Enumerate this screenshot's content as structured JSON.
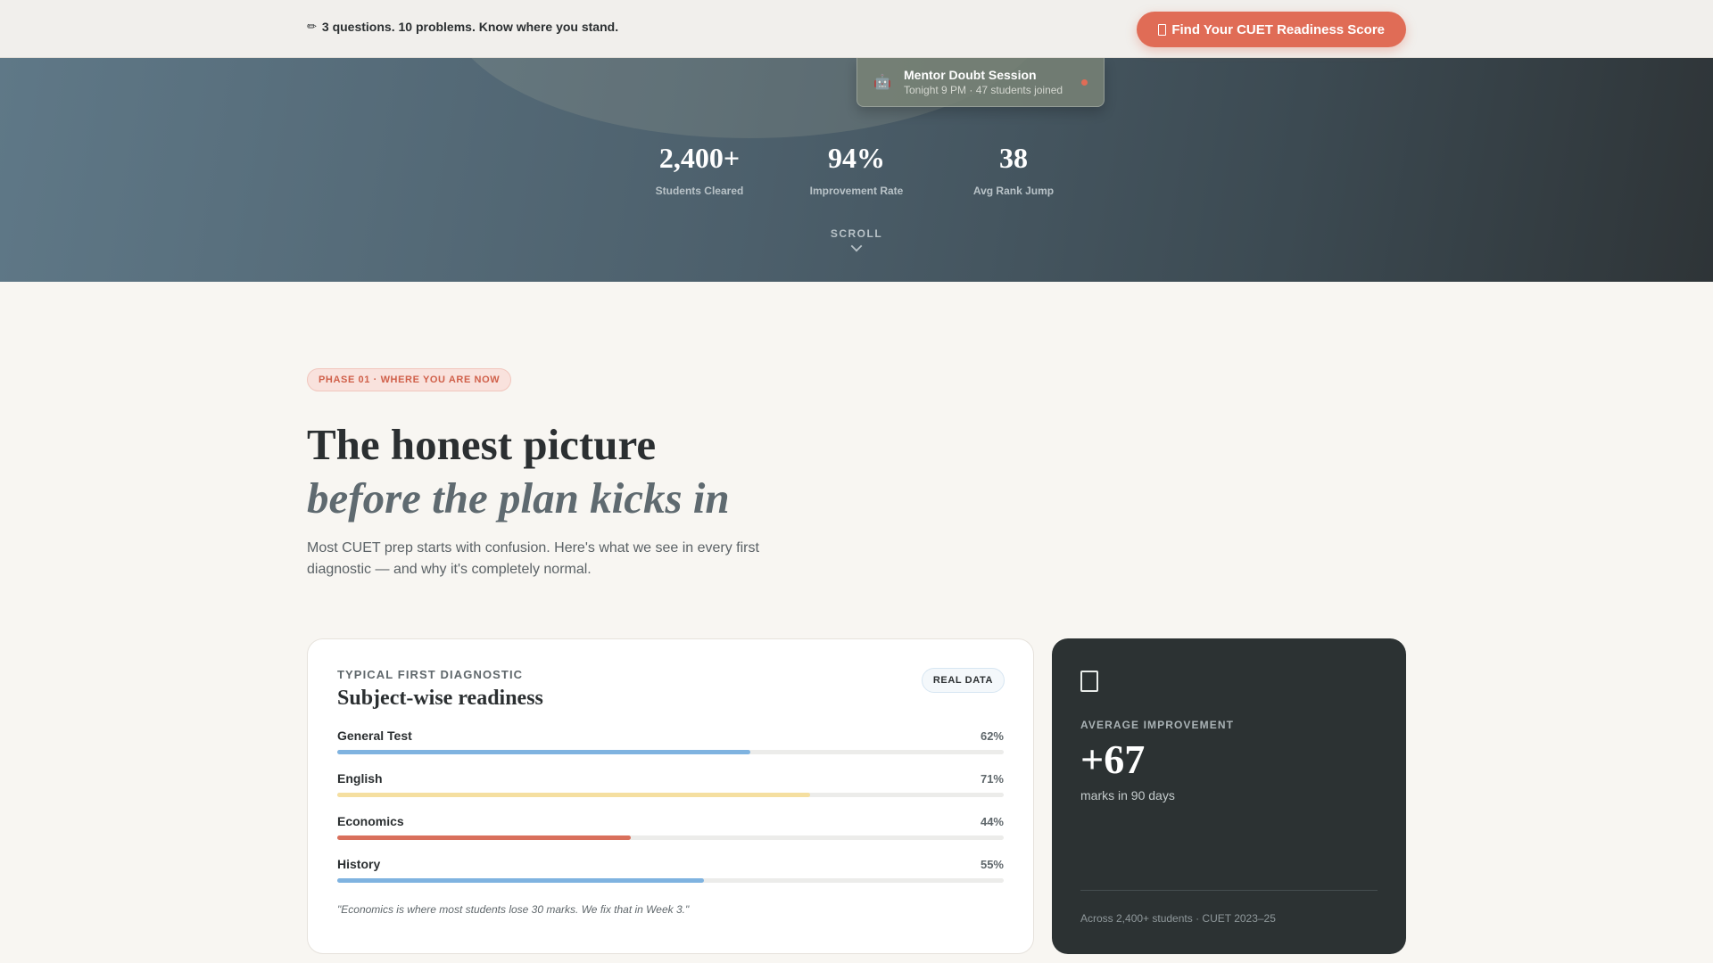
{
  "topbar": {
    "pencil_icon": "✏",
    "message": "3 questions. 10 problems. Know where you stand.",
    "cta_label": "Find Your CUET Readiness Score"
  },
  "hero": {
    "mentor": {
      "icon": "robot-icon",
      "title": "Mentor Doubt Session",
      "subtitle": "Tonight 9 PM · 47 students joined"
    },
    "stats": [
      {
        "value": "2,400+",
        "label": "Students Cleared"
      },
      {
        "value": "94%",
        "label": "Improvement Rate"
      },
      {
        "value": "38",
        "label": "Avg Rank Jump"
      }
    ],
    "scroll_label": "SCROLL"
  },
  "section": {
    "phase_badge": "PHASE 01 · WHERE YOU ARE NOW",
    "heading_line1": "The honest picture",
    "heading_line2": "before the plan kicks in",
    "intro": "Most CUET prep starts with confusion. Here's what we see in every first diagnostic — and why it's completely normal."
  },
  "readiness_card": {
    "eyebrow": "TYPICAL FIRST DIAGNOSTIC",
    "title": "Subject-wise readiness",
    "badge": "REAL DATA",
    "subjects": [
      {
        "name": "General Test",
        "pct_label": "62%",
        "value": 62,
        "color": "#7fb3e0"
      },
      {
        "name": "English",
        "pct_label": "71%",
        "value": 71,
        "color": "#f5dfa0"
      },
      {
        "name": "Economics",
        "pct_label": "44%",
        "value": 44,
        "color": "#d9705c"
      },
      {
        "name": "History",
        "pct_label": "55%",
        "value": 55,
        "color": "#7fb3e0"
      }
    ],
    "quote": "\"Economics is where most students lose 30 marks. We fix that in Week 3.\""
  },
  "improvement_card": {
    "icon": "chart-icon",
    "eyebrow": "AVERAGE IMPROVEMENT",
    "value": "+67",
    "subtitle": "marks in 90 days",
    "footnote": "Across 2,400+ students · CUET 2023–25"
  },
  "colors": {
    "accent": "#e06c56",
    "dark_card": "#2c3233",
    "page_bg": "#f8f6f2"
  }
}
